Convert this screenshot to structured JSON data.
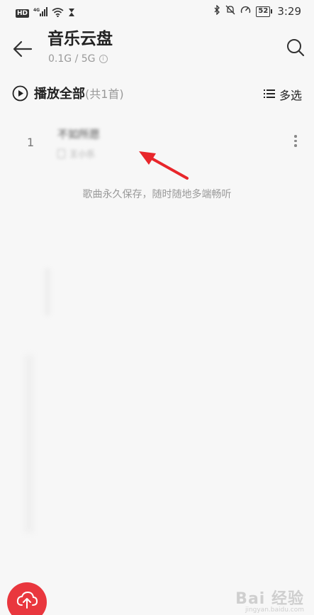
{
  "status_bar": {
    "hd": "HD",
    "network": "4G",
    "battery": "52",
    "time": "3:29"
  },
  "header": {
    "title": "音乐云盘",
    "capacity": "0.1G / 5G"
  },
  "play_all": {
    "label": "播放全部",
    "count": "(共1首)"
  },
  "multi_select": {
    "label": "多选"
  },
  "songs": [
    {
      "index": "1",
      "title": "不如所愿",
      "subtitle": "王小乐"
    }
  ],
  "hint": "歌曲永久保存，随时随地多端畅听",
  "watermark": {
    "main": "Bai 经验",
    "sub": "jingyan.baidu.com"
  },
  "colors": {
    "accent": "#e9373e",
    "annotation_arrow": "#e8262b"
  }
}
